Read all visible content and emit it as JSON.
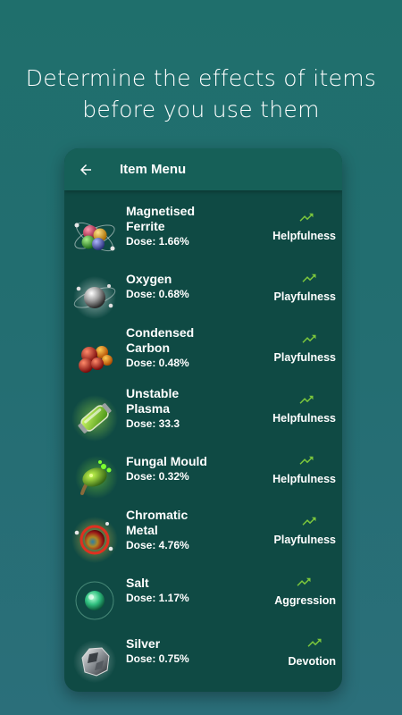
{
  "headline": {
    "line1": "Determine the effects of items",
    "line2": "before you use them"
  },
  "appbar": {
    "back_icon": "arrow-left-icon",
    "title": "Item Menu"
  },
  "colors": {
    "background": "#236e71",
    "panel": "#0f4a44",
    "appbar": "#166058",
    "trend_green": "#7cc73c"
  },
  "items": [
    {
      "icon": "magnetised-ferrite-icon",
      "name_line1": "Magnetised",
      "name_line2": "Ferrite",
      "dose": "Dose: 1.66%",
      "effect": "Helpfulness"
    },
    {
      "icon": "oxygen-icon",
      "name_line1": "Oxygen",
      "name_line2": "",
      "dose": "Dose: 0.68%",
      "effect": "Playfulness"
    },
    {
      "icon": "condensed-carbon-icon",
      "name_line1": "Condensed",
      "name_line2": "Carbon",
      "dose": "Dose: 0.48%",
      "effect": "Playfulness"
    },
    {
      "icon": "unstable-plasma-icon",
      "name_line1": "Unstable",
      "name_line2": "Plasma",
      "dose": "Dose: 33.3",
      "effect": "Helpfulness"
    },
    {
      "icon": "fungal-mould-icon",
      "name_line1": "Fungal Mould",
      "name_line2": "",
      "dose": "Dose: 0.32%",
      "effect": "Helpfulness"
    },
    {
      "icon": "chromatic-metal-icon",
      "name_line1": "Chromatic",
      "name_line2": "Metal",
      "dose": "Dose: 4.76%",
      "effect": "Playfulness"
    },
    {
      "icon": "salt-icon",
      "name_line1": "Salt",
      "name_line2": "",
      "dose": "Dose: 1.17%",
      "effect": "Aggression"
    },
    {
      "icon": "silver-icon",
      "name_line1": "Silver",
      "name_line2": "",
      "dose": "Dose: 0.75%",
      "effect": "Devotion"
    }
  ],
  "trend_icon": "trending-up-icon"
}
